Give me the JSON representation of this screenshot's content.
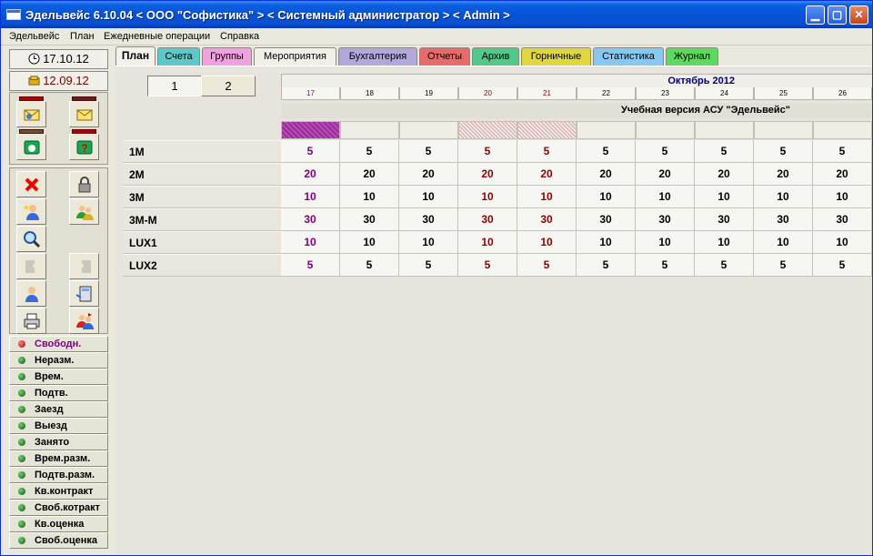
{
  "window": {
    "title": "Эдельвейс 6.10.04 < ООО \"Софистика\" > < Системный администратор > < Admin >"
  },
  "menu": [
    "Эдельвейс",
    "План",
    "Ежедневные операции",
    "Справка"
  ],
  "dates": {
    "current": "17.10.12",
    "billing": "12.09.12"
  },
  "statuses": [
    {
      "label": "Свободн.",
      "active": true
    },
    {
      "label": "Неразм."
    },
    {
      "label": "Врем."
    },
    {
      "label": "Подтв."
    },
    {
      "label": "Заезд"
    },
    {
      "label": "Выезд"
    },
    {
      "label": "Занято"
    },
    {
      "label": "Врем.разм."
    },
    {
      "label": "Подтв.разм."
    },
    {
      "label": "Кв.контракт"
    },
    {
      "label": "Своб.котракт"
    },
    {
      "label": "Кв.оценка"
    },
    {
      "label": "Своб.оценка"
    }
  ],
  "tabs": [
    {
      "label": "План",
      "color": "#f2f1ea",
      "active": true
    },
    {
      "label": "Счета",
      "color": "#5ec8c8"
    },
    {
      "label": "Группы",
      "color": "#f3a0e0"
    },
    {
      "label": "Мероприятия",
      "color": "#f0efe8"
    },
    {
      "label": "Бухгалтерия",
      "color": "#b2a8dc"
    },
    {
      "label": "Отчеты",
      "color": "#e86a6a"
    },
    {
      "label": "Архив",
      "color": "#52c88a"
    },
    {
      "label": "Горничные",
      "color": "#e0d640"
    },
    {
      "label": "Статистика",
      "color": "#88c8f0"
    },
    {
      "label": "Журнал",
      "color": "#5fd85f"
    }
  ],
  "pages": [
    "1",
    "2"
  ],
  "plan": {
    "month": "Октябрь 2012",
    "banner": "Учебная версия АСУ \"Эдельвейс\"",
    "days": [
      {
        "label": "17",
        "color": "purple",
        "occ": "full"
      },
      {
        "label": "18"
      },
      {
        "label": "19"
      },
      {
        "label": "20",
        "color": "red",
        "occ": "half"
      },
      {
        "label": "21",
        "color": "red",
        "occ": "half"
      },
      {
        "label": "22"
      },
      {
        "label": "23"
      },
      {
        "label": "24"
      },
      {
        "label": "25"
      },
      {
        "label": "26"
      }
    ],
    "rows": [
      {
        "type": "1M",
        "counts": [
          "5",
          "5",
          "5",
          "5",
          "5",
          "5",
          "5",
          "5",
          "5",
          "5"
        ]
      },
      {
        "type": "2M",
        "counts": [
          "20",
          "20",
          "20",
          "20",
          "20",
          "20",
          "20",
          "20",
          "20",
          "20"
        ]
      },
      {
        "type": "3M",
        "counts": [
          "10",
          "10",
          "10",
          "10",
          "10",
          "10",
          "10",
          "10",
          "10",
          "10"
        ]
      },
      {
        "type": "3M-M",
        "counts": [
          "30",
          "30",
          "30",
          "30",
          "30",
          "30",
          "30",
          "30",
          "30",
          "30"
        ]
      },
      {
        "type": "LUX1",
        "counts": [
          "10",
          "10",
          "10",
          "10",
          "10",
          "10",
          "10",
          "10",
          "10",
          "10"
        ]
      },
      {
        "type": "LUX2",
        "counts": [
          "5",
          "5",
          "5",
          "5",
          "5",
          "5",
          "5",
          "5",
          "5",
          "5"
        ]
      }
    ]
  }
}
